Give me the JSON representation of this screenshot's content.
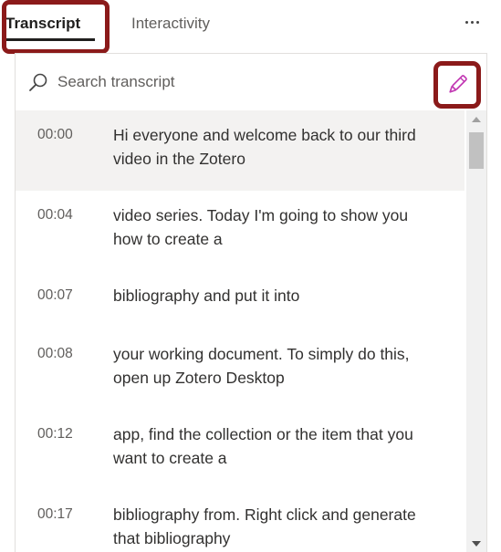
{
  "tabs": {
    "transcript": "Transcript",
    "interactivity": "Interactivity"
  },
  "search": {
    "placeholder": "Search transcript"
  },
  "colors": {
    "highlight": "#8b1a1a",
    "edit_icon": "#c239b3",
    "selected_row": "#f3f2f1"
  },
  "icons": {
    "search": "search-icon",
    "edit": "pencil-icon",
    "more": "more-options-icon"
  },
  "transcript": [
    {
      "time": "00:00",
      "text": "Hi everyone and welcome back to our third video in the Zotero"
    },
    {
      "time": "00:04",
      "text": "video series. Today I'm going to show you how to create a"
    },
    {
      "time": "00:07",
      "text": "bibliography and put it into"
    },
    {
      "time": "00:08",
      "text": "your working document. To simply do this, open up Zotero Desktop"
    },
    {
      "time": "00:12",
      "text": "app, find the collection or the item that you want to create a"
    },
    {
      "time": "00:17",
      "text": "bibliography from. Right click and generate that bibliography"
    }
  ]
}
